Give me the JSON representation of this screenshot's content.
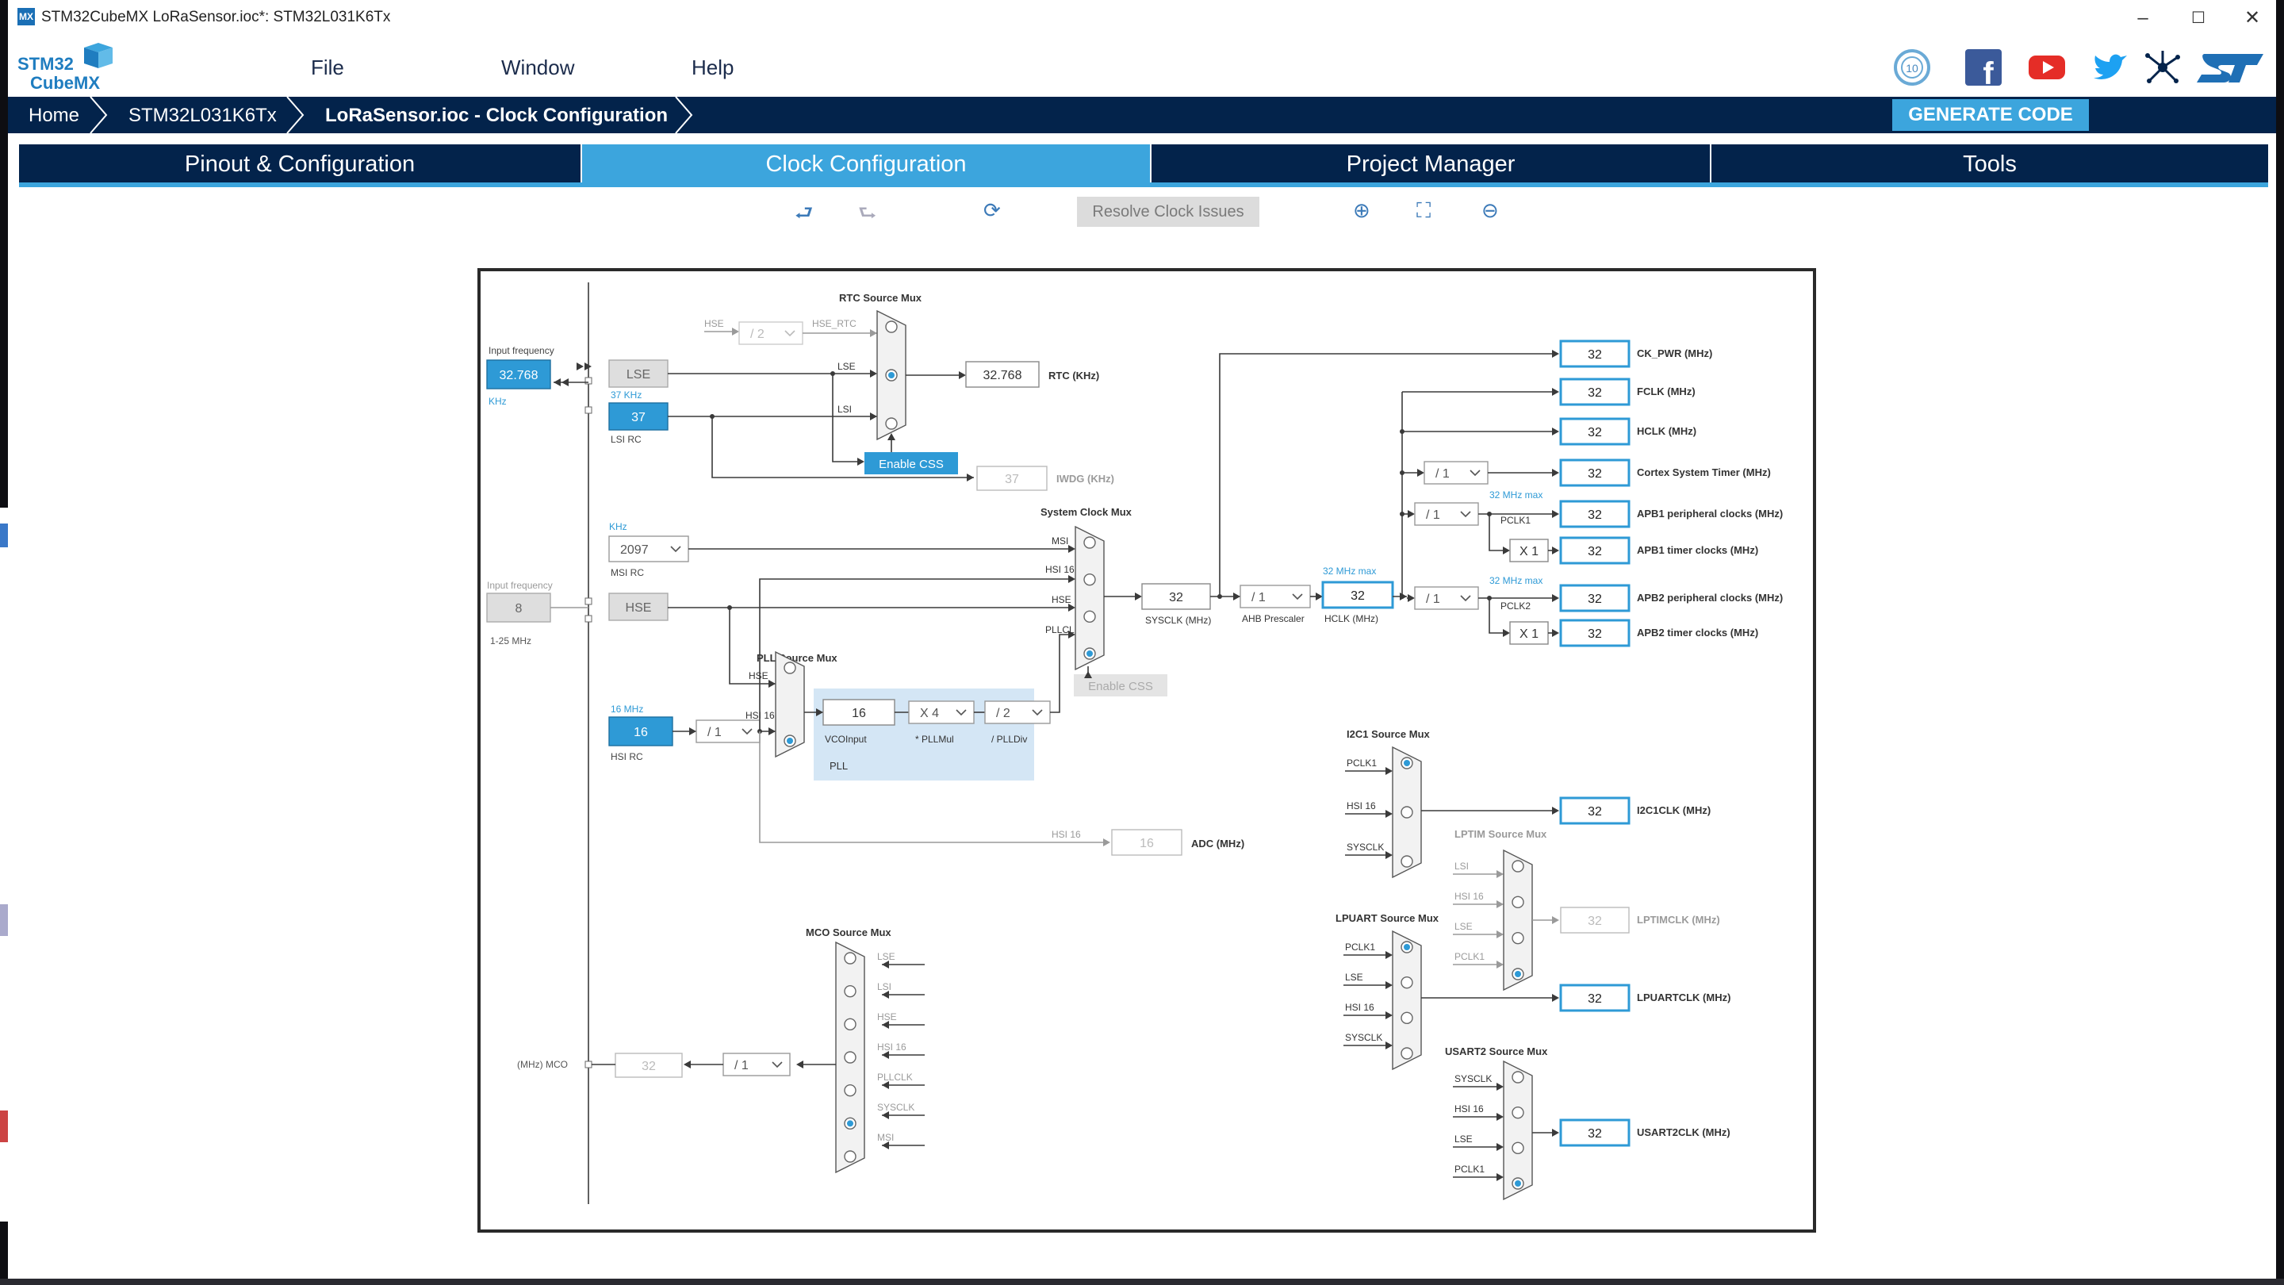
{
  "window": {
    "app_icon": "MX",
    "title": "STM32CubeMX LoRaSensor.ioc*: STM32L031K6Tx"
  },
  "logo": {
    "line1": "STM32",
    "line2": "CubeMX"
  },
  "menu": [
    {
      "label": "File"
    },
    {
      "label": "Window"
    },
    {
      "label": "Help"
    }
  ],
  "breadcrumb": [
    {
      "label": "Home"
    },
    {
      "label": "STM32L031K6Tx"
    },
    {
      "label": "LoRaSensor.ioc - Clock Configuration"
    }
  ],
  "generate_label": "GENERATE CODE",
  "tabs": [
    {
      "label": "Pinout & Configuration"
    },
    {
      "label": "Clock Configuration"
    },
    {
      "label": "Project Manager"
    },
    {
      "label": "Tools"
    }
  ],
  "toolbar": {
    "resolve_label": "Resolve Clock Issues"
  },
  "icons": {
    "undo": "undo-icon",
    "redo": "redo-icon",
    "reset": "refresh-icon",
    "zoom_in": "zoom-in-icon",
    "fit": "fit-icon",
    "zoom_out": "zoom-out-icon"
  },
  "colors": {
    "navy": "#03234b",
    "accent": "#3ca5dd",
    "selected_box": "#2e9ad6"
  },
  "clock": {
    "input_frequency_label": "Input frequency",
    "lse_input": "32.768",
    "lse_unit": "KHz",
    "lse_label": "LSE",
    "lsi_freq_label": "37 KHz",
    "lsi_value": "37",
    "lsi_label": "LSI RC",
    "hse_input": "8",
    "hse_label": "HSE",
    "hse_range": "1-25 MHz",
    "msi_unit": "KHz",
    "msi_value": "2097",
    "msi_label": "MSI RC",
    "hsi_freq_label": "16 MHz",
    "hsi_value": "16",
    "hsi_label": "HSI RC",
    "rtc_mux_title": "RTC Source Mux",
    "hse_rtc_div": "/ 2",
    "hse_rtc_label": "HSE_RTC",
    "mux_in_hse": "HSE",
    "mux_in_lse": "LSE",
    "mux_in_lsi": "LSI",
    "rtc_value": "32.768",
    "rtc_label": "RTC (KHz)",
    "enable_css": "Enable CSS",
    "iwdg_value": "37",
    "iwdg_label": "IWDG (KHz)",
    "sysclk_mux_title": "System Clock Mux",
    "mux_in_msi": "MSI",
    "mux_in_hsi16": "HSI 16",
    "mux_in_pllclk": "PLLCLK",
    "enable_css2": "Enable CSS",
    "sysclk_value": "32",
    "sysclk_label": "SYSCLK (MHz)",
    "ahb_div": "/ 1",
    "ahb_label": "AHB Prescaler",
    "hclk_max": "32 MHz max",
    "hclk_value": "32",
    "hclk_label": "HCLK (MHz)",
    "pll_mux_title": "PLL Source Mux",
    "hsi_div": "/ 1",
    "vco_value": "16",
    "vco_label": "VCOInput",
    "pllmul": "X 4",
    "pllmul_label": "* PLLMul",
    "plldiv": "/ 2",
    "plldiv_label": "/ PLLDiv",
    "pll_label": "PLL",
    "adc_src": "HSI 16",
    "adc_value": "16",
    "adc_label": "ADC (MHz)",
    "cortex_div": "/ 1",
    "apb1_div": "/ 1",
    "apb1_max": "32 MHz max",
    "pclk1_label": "PCLK1",
    "apb1_timer_mul": "X 1",
    "apb2_div": "/ 1",
    "apb2_max": "32 MHz max",
    "pclk2_label": "PCLK2",
    "apb2_timer_mul": "X 1",
    "outputs": [
      {
        "value": "32",
        "label": "CK_PWR (MHz)"
      },
      {
        "value": "32",
        "label": "FCLK (MHz)"
      },
      {
        "value": "32",
        "label": "HCLK (MHz)"
      },
      {
        "value": "32",
        "label": "Cortex System Timer (MHz)"
      },
      {
        "value": "32",
        "label": "APB1 peripheral clocks (MHz)"
      },
      {
        "value": "32",
        "label": "APB1 timer clocks (MHz)"
      },
      {
        "value": "32",
        "label": "APB2 peripheral clocks (MHz)"
      },
      {
        "value": "32",
        "label": "APB2 timer clocks (MHz)"
      }
    ],
    "i2c1_mux_title": "I2C1 Source Mux",
    "i2c1_inputs": [
      "PCLK1",
      "HSI 16",
      "SYSCLK"
    ],
    "i2c1_value": "32",
    "i2c1_label": "I2C1CLK (MHz)",
    "lptim_mux_title": "LPTIM Source Mux",
    "lptim_inputs": [
      "LSI",
      "HSI 16",
      "LSE",
      "PCLK1"
    ],
    "lptim_value": "32",
    "lptim_label": "LPTIMCLK (MHz)",
    "lpuart_mux_title": "LPUART Source Mux",
    "lpuart_inputs": [
      "PCLK1",
      "LSE",
      "HSI 16",
      "SYSCLK"
    ],
    "lpuart_value": "32",
    "lpuart_label": "LPUARTCLK (MHz)",
    "usart2_mux_title": "USART2 Source Mux",
    "usart2_inputs": [
      "SYSCLK",
      "HSI 16",
      "LSE",
      "PCLK1"
    ],
    "usart2_value": "32",
    "usart2_label": "USART2CLK (MHz)",
    "mco_mux_title": "MCO Source Mux",
    "mco_inputs": [
      "LSE",
      "LSI",
      "HSE",
      "HSI 16",
      "PLLCLK",
      "SYSCLK",
      "MSI"
    ],
    "mco_div": "/ 1",
    "mco_value": "32",
    "mco_label": "(MHz) MCO"
  }
}
